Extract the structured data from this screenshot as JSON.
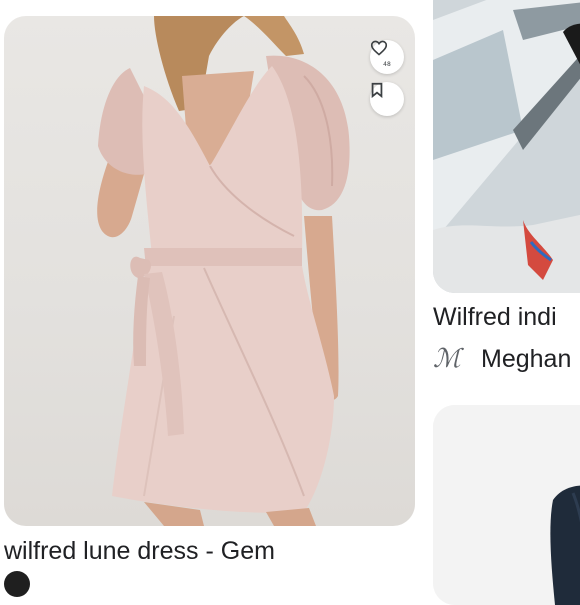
{
  "results": [
    {
      "title": "wilfred lune dress - Gem",
      "image_alt": "pink satin wrap dress with puff sleeves",
      "heart_icon": "heart-outline-icon",
      "heart_count": "48",
      "save_icon": "bookmark-icon"
    },
    {
      "title": "Wilfred indi",
      "source_logo": "ΩC",
      "source_name": "Meghan"
    },
    {
      "title": ""
    }
  ],
  "colors": {
    "dress": "#e8cfc9",
    "dress_shadow": "#d4b3ac",
    "skin": "#d7a98f",
    "hair": "#b88a5c",
    "background": "#e6e3e0"
  }
}
